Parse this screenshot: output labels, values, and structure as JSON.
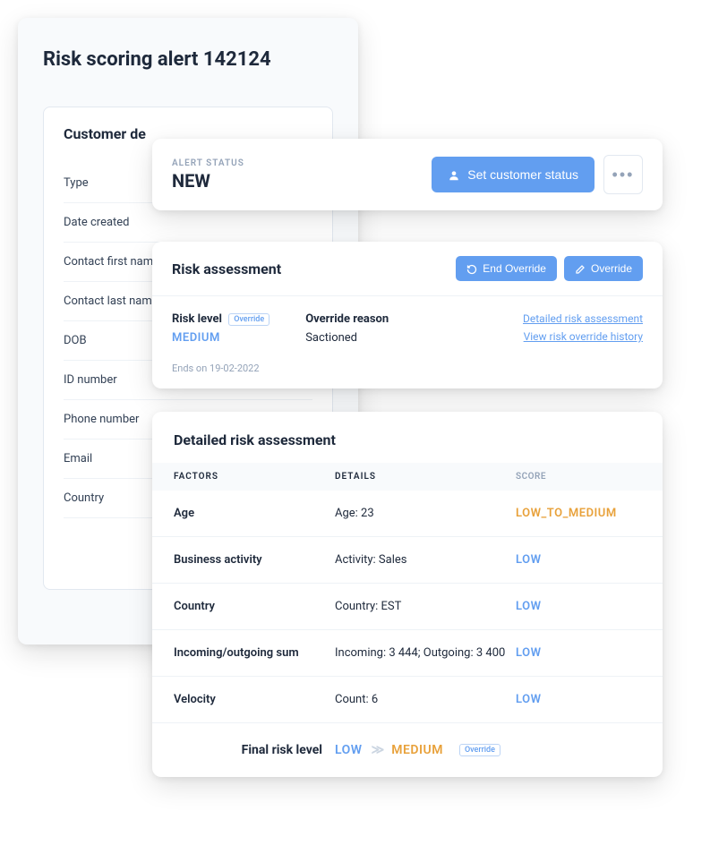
{
  "main": {
    "title": "Risk scoring alert 142124",
    "customer_card_title": "Customer de",
    "fields": [
      "Type",
      "Date created",
      "Contact first nam",
      "Contact last nam",
      "DOB",
      "ID number",
      "Phone number",
      "Email",
      "Country"
    ]
  },
  "status": {
    "label": "ALERT STATUS",
    "value": "NEW",
    "set_button": "Set customer status"
  },
  "risk": {
    "title": "Risk assessment",
    "end_override_btn": "End Override",
    "override_btn": "Override",
    "risk_level_label": "Risk level",
    "override_badge": "Override",
    "risk_level_value": "MEDIUM",
    "reason_label": "Override reason",
    "reason_value": "Sactioned",
    "link_detailed": "Detailed risk assessment",
    "link_history": "View risk override history",
    "ends_note": "Ends on 19-02-2022"
  },
  "detail": {
    "title": "Detailed risk assessment",
    "col_factors": "FACTORS",
    "col_details": "DETAILS",
    "col_score": "SCORE",
    "rows": [
      {
        "factor": "Age",
        "details": "Age: 23",
        "score": "LOW_TO_MEDIUM",
        "score_class": "lowmed"
      },
      {
        "factor": "Business activity",
        "details": "Activity: Sales",
        "score": "LOW",
        "score_class": "low"
      },
      {
        "factor": "Country",
        "details": "Country: EST",
        "score": "LOW",
        "score_class": "low"
      },
      {
        "factor": "Incoming/outgoing sum",
        "details": "Incoming: 3 444; Outgoing: 3 400",
        "score": "LOW",
        "score_class": "low"
      },
      {
        "factor": "Velocity",
        "details": "Count: 6",
        "score": "LOW",
        "score_class": "low"
      }
    ],
    "final_label": "Final risk level",
    "final_from": "LOW",
    "final_to": "MEDIUM",
    "final_badge": "Override"
  }
}
